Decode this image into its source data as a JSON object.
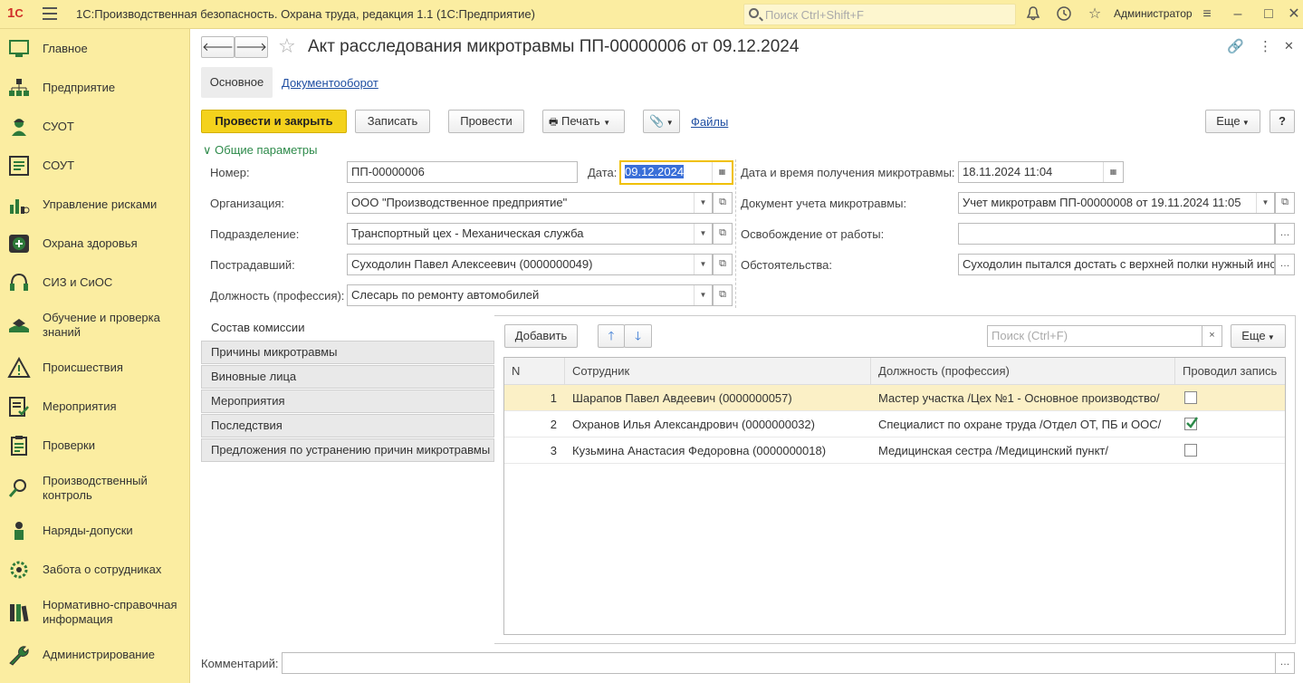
{
  "topbar": {
    "app_title": "1С:Производственная безопасность. Охрана труда, редакция 1.1  (1С:Предприятие)",
    "search_placeholder": "Поиск Ctrl+Shift+F",
    "user": "Администратор"
  },
  "sidebar": {
    "items": [
      {
        "label": "Главное"
      },
      {
        "label": "Предприятие"
      },
      {
        "label": "СУОТ"
      },
      {
        "label": "СОУТ"
      },
      {
        "label": "Управление рисками"
      },
      {
        "label": "Охрана здоровья"
      },
      {
        "label": "СИЗ и СиОС"
      },
      {
        "label": "Обучение и проверка знаний"
      },
      {
        "label": "Происшествия"
      },
      {
        "label": "Мероприятия"
      },
      {
        "label": "Проверки"
      },
      {
        "label": "Производственный контроль"
      },
      {
        "label": "Наряды-допуски"
      },
      {
        "label": "Забота о сотрудниках"
      },
      {
        "label": "Нормативно-справочная информация"
      },
      {
        "label": "Администрирование"
      }
    ]
  },
  "document": {
    "title": "Акт расследования микротравмы ПП-00000006 от 09.12.2024",
    "tabs": [
      "Основное",
      "Документооборот"
    ],
    "toolbar": {
      "post_close": "Провести и закрыть",
      "save": "Записать",
      "post": "Провести",
      "print": "Печать",
      "files": "Файлы",
      "more": "Еще",
      "help": "?"
    },
    "group_title": "Общие параметры",
    "fields": {
      "number_label": "Номер:",
      "number": "ПП-00000006",
      "date_label": "Дата:",
      "date": "09.12.2024",
      "org_label": "Организация:",
      "org": "ООО \"Производственное предприятие\"",
      "dept_label": "Подразделение:",
      "dept": "Транспортный цех - Механическая служба",
      "victim_label": "Пострадавший:",
      "victim": "Суходолин Павел Алексеевич (0000000049)",
      "position_label": "Должность (профессия):",
      "position": "Слесарь по ремонту автомобилей",
      "received_label": "Дата и время получения микротравмы:",
      "received": "18.11.2024 11:04",
      "accounting_doc_label": "Документ учета микротравмы:",
      "accounting_doc": "Учет микротравм ПП-00000008 от 19.11.2024 11:05",
      "release_label": "Освобождение от работы:",
      "release": "",
      "circumstances_label": "Обстоятельства:",
      "circumstances": "Суходолин пытался достать с верхней полки нужный инс"
    },
    "sections": [
      "Состав комиссии",
      "Причины микротравмы",
      "Виновные лица",
      "Мероприятия",
      "Последствия",
      "Предложения по устранению причин микротравмы"
    ],
    "table_toolbar": {
      "add": "Добавить",
      "search_placeholder": "Поиск (Ctrl+F)",
      "clear": "×",
      "more": "Еще"
    },
    "table": {
      "headers": [
        "N",
        "Сотрудник",
        "Должность (профессия)",
        "Проводил запись"
      ],
      "rows": [
        {
          "n": "1",
          "employee": "Шарапов Павел Авдеевич (0000000057)",
          "position": "Мастер участка /Цех №1 - Основное производство/",
          "checked": false
        },
        {
          "n": "2",
          "employee": "Охранов Илья Александрович (0000000032)",
          "position": "Специалист по охране труда /Отдел ОТ, ПБ и ООС/",
          "checked": true
        },
        {
          "n": "3",
          "employee": "Кузьмина Анастасия Федоровна (0000000018)",
          "position": "Медицинская сестра /Медицинский пункт/",
          "checked": false
        }
      ]
    },
    "comment_label": "Комментарий:",
    "comment": ""
  }
}
